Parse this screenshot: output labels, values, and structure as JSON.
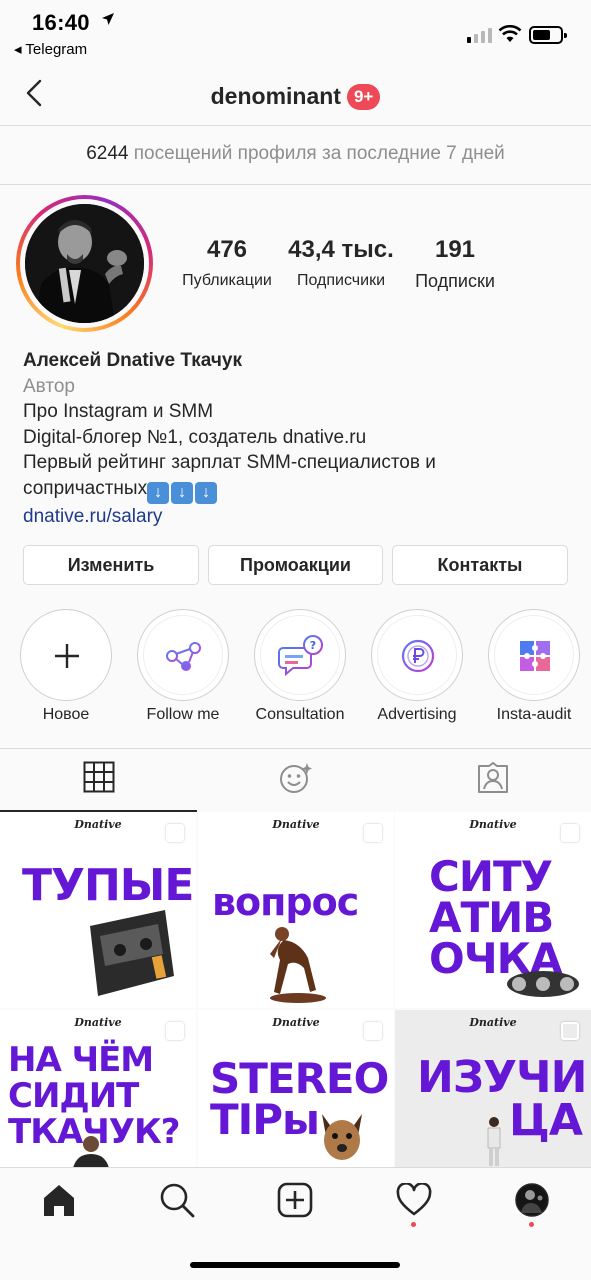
{
  "status_bar": {
    "time": "16:40",
    "back_app": "◂ Telegram"
  },
  "header": {
    "username": "denominant",
    "notifications_badge": "9+"
  },
  "visits_banner": {
    "count": "6244",
    "text": "посещений профиля за последние 7 дней"
  },
  "stats": [
    {
      "value": "476",
      "label": "Публикации"
    },
    {
      "value": "43,4 тыс.",
      "label": "Подписчики"
    },
    {
      "value": "191",
      "label": "Подписки"
    }
  ],
  "bio": {
    "full_name": "Алексей Dnative Ткачук",
    "category": "Автор",
    "line1": "Про Instagram и SMM",
    "line2": "Digital-блогер №1, создатель dnative.ru",
    "line3": "Первый рейтинг зарплат SMM-специалистов и",
    "line4": "сопричастных",
    "link": "dnative.ru/salary"
  },
  "buttons": {
    "edit": "Изменить",
    "promo": "Промоакции",
    "contacts": "Контакты"
  },
  "highlights": [
    {
      "label": "Новое",
      "icon": "plus-icon"
    },
    {
      "label": "Follow me",
      "icon": "share-icon"
    },
    {
      "label": "Consultation",
      "icon": "chat-question-icon"
    },
    {
      "label": "Advertising",
      "icon": "coin-p-icon"
    },
    {
      "label": "Insta-audit",
      "icon": "puzzle-icon"
    }
  ],
  "tabs": [
    {
      "name": "grid",
      "icon": "grid-icon",
      "active": true
    },
    {
      "name": "reels",
      "icon": "smile-sparkle-icon",
      "active": false
    },
    {
      "name": "tagged",
      "icon": "tagged-person-icon",
      "active": false
    }
  ],
  "posts": [
    {
      "brand": "Dnative",
      "text": "ТУПЫЕ"
    },
    {
      "brand": "Dnative",
      "text": "вопрос"
    },
    {
      "brand": "Dnative",
      "line1": "СИТУ",
      "line2": "АТИВ",
      "line3": "ОЧКА"
    },
    {
      "brand": "Dnative",
      "line1": "НА ЧЁМ",
      "line2": "СИДИТ",
      "line3": "ТКАЧУК?"
    },
    {
      "brand": "Dnative",
      "line1": "STEREO",
      "line2": "TIPы"
    },
    {
      "brand": "Dnative",
      "line1": "ИЗУЧИ",
      "line2": "ЦА"
    }
  ],
  "bottom_nav": [
    {
      "name": "home",
      "icon": "home-icon"
    },
    {
      "name": "search",
      "icon": "search-icon"
    },
    {
      "name": "new-post",
      "icon": "add-square-icon"
    },
    {
      "name": "activity",
      "icon": "heart-icon"
    },
    {
      "name": "profile",
      "icon": "avatar-icon"
    }
  ],
  "colors": {
    "accent_purple": "#6417d4",
    "badge_red": "#ed4956",
    "link_blue": "#1e3a8a"
  }
}
